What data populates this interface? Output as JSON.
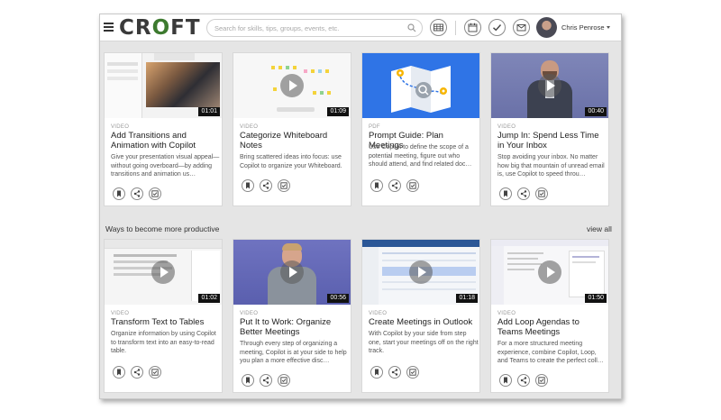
{
  "header": {
    "logo": {
      "before": "CR",
      "o": "O",
      "after": "FT"
    },
    "search_placeholder": "Search for skills, tips, groups, events, etc.",
    "user_name": "Chris Penrose"
  },
  "icons": {
    "menu": "hamburger-menu-icon",
    "search": "search-icon",
    "grid": "grid-icon",
    "calendar": "calendar-icon",
    "check": "checkmark-icon",
    "mail": "mail-icon",
    "bookmark": "bookmark-icon",
    "share": "share-icon",
    "save": "save-icon",
    "play": "play-icon"
  },
  "colors": {
    "brand_green": "#3d7a2f",
    "background": "#e5e5e5"
  },
  "row1": [
    {
      "type": "VIDEO",
      "title": "Add Transitions and Animation with Copilot",
      "desc": "Give your presentation visual appeal—without going overboard—by adding transitions and animation us…",
      "duration": "01:01"
    },
    {
      "type": "VIDEO",
      "title": "Categorize Whiteboard Notes",
      "desc": "Bring scattered ideas into focus: use Copilot to organize your Whiteboard.",
      "duration": "01:09"
    },
    {
      "type": "PDF",
      "title": "Prompt Guide: Plan Meetings",
      "desc": "Use Copilot to define the scope of a potential meeting, figure out who should attend, and find related doc…",
      "duration": ""
    },
    {
      "type": "VIDEO",
      "title": "Jump In: Spend Less Time in Your Inbox",
      "desc": "Stop avoiding your inbox. No matter how big that mountain of unread email is, use Copilot to speed throu…",
      "duration": "00:40"
    }
  ],
  "section": {
    "title": "Ways to become more productive",
    "view_all": "view all"
  },
  "row2": [
    {
      "type": "VIDEO",
      "title": "Transform Text to Tables",
      "desc": "Organize information by using Copilot to transform text into an easy-to-read table.",
      "duration": "01:02"
    },
    {
      "type": "VIDEO",
      "title": "Put It to Work: Organize Better Meetings",
      "desc": "Through every step of organizing a meeting, Copilot is at your side to help you plan a more effective disc…",
      "duration": "00:56"
    },
    {
      "type": "VIDEO",
      "title": "Create Meetings in Outlook",
      "desc": "With Copilot by your side from step one, start your meetings off on the right track.",
      "duration": "01:18"
    },
    {
      "type": "VIDEO",
      "title": "Add Loop Agendas to Teams Meetings",
      "desc": "For a more structured meeting experience, combine Copilot, Loop, and Teams to create the perfect coll…",
      "duration": "01:50"
    }
  ]
}
